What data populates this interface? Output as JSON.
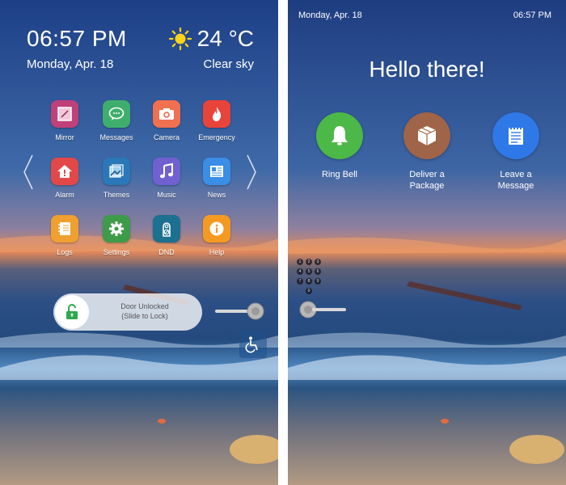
{
  "left_screen": {
    "clock": {
      "time": "06:57 PM",
      "date": "Monday, Apr. 18"
    },
    "weather": {
      "temperature": "24 °C",
      "condition": "Clear sky",
      "icon": "sun-icon"
    },
    "apps": [
      {
        "label": "Mirror",
        "icon": "mirror-icon",
        "color": "#c0407a"
      },
      {
        "label": "Messages",
        "icon": "messages-icon",
        "color": "#3fae6c"
      },
      {
        "label": "Camera",
        "icon": "camera-icon",
        "color": "#f07050"
      },
      {
        "label": "Emergency",
        "icon": "fire-icon",
        "color": "#e8443a"
      },
      {
        "label": "Alarm",
        "icon": "home-alarm-icon",
        "color": "#e34848"
      },
      {
        "label": "Themes",
        "icon": "themes-icon",
        "color": "#2a78b8"
      },
      {
        "label": "Music",
        "icon": "music-icon",
        "color": "#7060d0"
      },
      {
        "label": "News",
        "icon": "news-icon",
        "color": "#3a8ee6"
      },
      {
        "label": "Logs",
        "icon": "logs-icon",
        "color": "#f0a030"
      },
      {
        "label": "Settings",
        "icon": "gear-icon",
        "color": "#3e9b4a"
      },
      {
        "label": "DND",
        "icon": "dnd-icon",
        "color": "#1c7090"
      },
      {
        "label": "Help",
        "icon": "info-icon",
        "color": "#f59a20"
      }
    ],
    "lock_slider": {
      "line1": "Door Unlocked",
      "line2": "(Slide to Lock)",
      "icon": "unlocked-padlock-icon",
      "accent": "#2fa84f"
    },
    "accessibility_icon": "wheelchair-icon"
  },
  "right_screen": {
    "status": {
      "date": "Monday, Apr. 18",
      "time": "06:57 PM"
    },
    "greeting": "Hello there!",
    "actions": [
      {
        "line1": "Ring Bell",
        "line2": "",
        "icon": "bell-icon",
        "color": "#4cb848"
      },
      {
        "line1": "Deliver a",
        "line2": "Package",
        "icon": "package-icon",
        "color": "#a06448"
      },
      {
        "line1": "Leave a",
        "line2": "Message",
        "icon": "notepad-icon",
        "color": "#2f78e8"
      }
    ],
    "keypad_keys": [
      "1",
      "2",
      "3",
      "4",
      "5",
      "6",
      "7",
      "8",
      "9",
      "0"
    ]
  }
}
